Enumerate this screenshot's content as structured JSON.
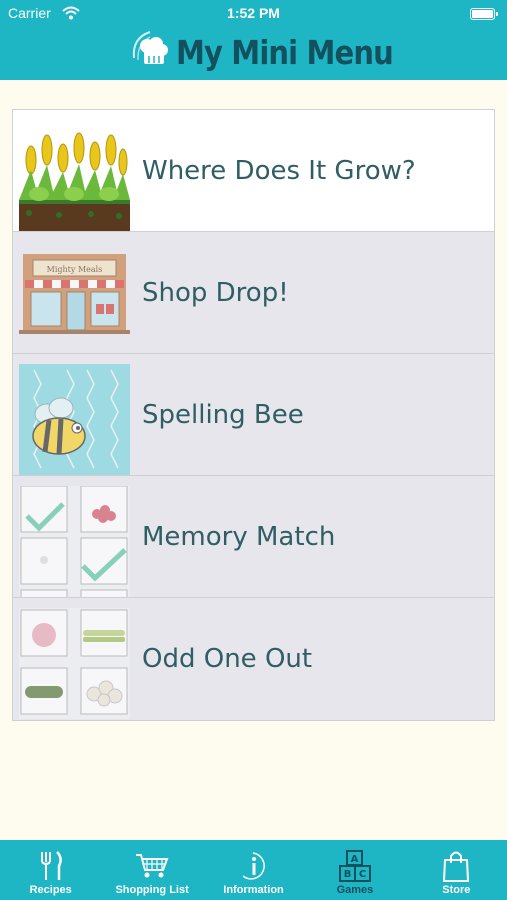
{
  "status_bar": {
    "carrier": "Carrier",
    "time": "1:52 PM"
  },
  "header": {
    "title": "My Mini Menu"
  },
  "games": [
    {
      "label": "Where Does It Grow?",
      "thumb": "corn-field-image",
      "selected": true
    },
    {
      "label": "Shop Drop!",
      "thumb": "shop-front-image",
      "sign": "Mighty Meals"
    },
    {
      "label": "Spelling Bee",
      "thumb": "bee-image"
    },
    {
      "label": "Memory Match",
      "thumb": "memory-cards-image"
    },
    {
      "label": "Odd One Out",
      "thumb": "vegetables-grid-image"
    }
  ],
  "tabbar": {
    "items": [
      {
        "label": "Recipes",
        "icon": "fork-knife-icon"
      },
      {
        "label": "Shopping List",
        "icon": "shopping-cart-icon"
      },
      {
        "label": "Information",
        "icon": "info-icon"
      },
      {
        "label": "Games",
        "icon": "abc-blocks-icon",
        "active": true
      },
      {
        "label": "Store",
        "icon": "shopping-bag-icon"
      }
    ]
  },
  "colors": {
    "brand": "#1eb6c5",
    "logo_text": "#13515f",
    "row_text": "#315e64",
    "background": "#fdfcee"
  }
}
